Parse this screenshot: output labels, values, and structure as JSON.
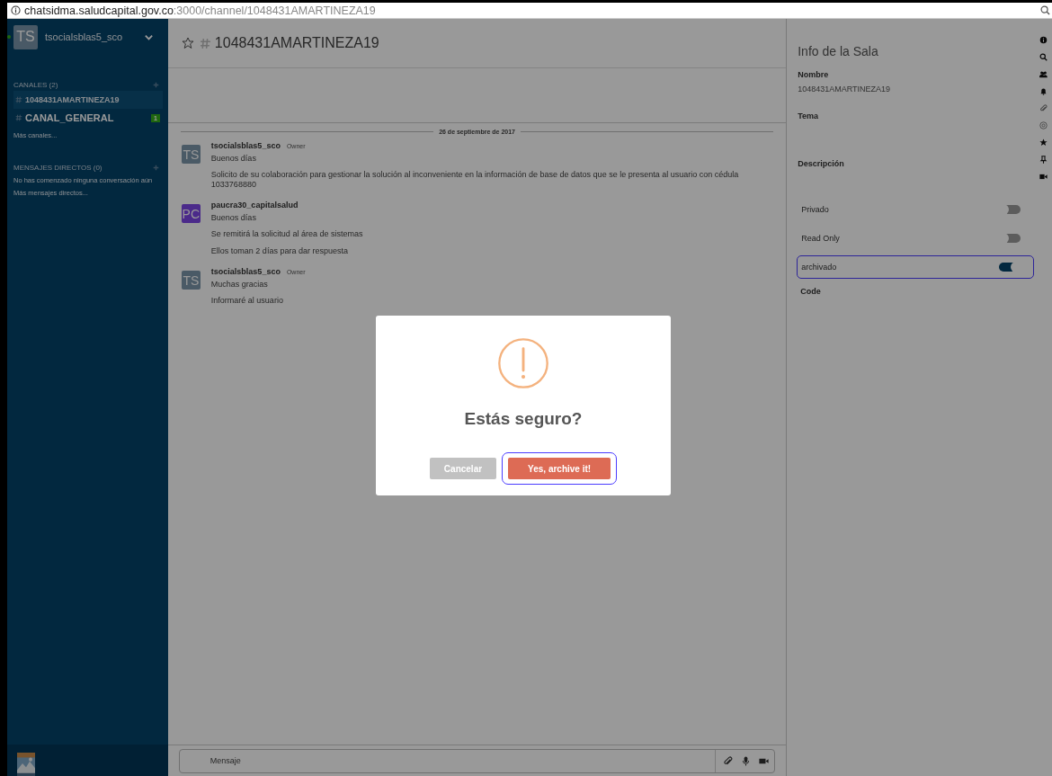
{
  "address_bar": {
    "host": "chatsidma.saludcapital.gov.co",
    "rest": ":3000/channel/1048431AMARTINEZA19"
  },
  "sidebar": {
    "user": {
      "initials": "TS",
      "name": "tsocialsblas5_sco",
      "online": true
    },
    "sections": [
      {
        "title": "CANALES (2)",
        "items": [
          {
            "name": "1048431AMARTINEZA19",
            "selected": true
          },
          {
            "name": "CANAL_GENERAL",
            "selected": false,
            "unread": "1"
          }
        ],
        "more": "Más canales..."
      },
      {
        "title": "MENSAJES DIRECTOS (0)",
        "note": "No has comenzado ninguna conversación aún",
        "more": "Más mensajes directos..."
      }
    ]
  },
  "room_header": {
    "title": "1048431AMARTINEZA19",
    "favorite": false
  },
  "date_divider": "26 de septiembre de 2017",
  "messages": [
    {
      "initials": "TS",
      "color": "#4a5a66",
      "user": "tsocialsblas5_sco",
      "role": "Owner",
      "lines": [
        "Buenos días",
        "Solicito de su colaboración para gestionar la solución al inconveniente en la información de base de datos que se le presenta al usuario con cédula 1033768880"
      ]
    },
    {
      "initials": "PC",
      "color": "#4b2a8a",
      "user": "paucra30_capitalsalud",
      "lines": [
        "Buenos días",
        "Se remitirá la solicitud al área de sistemas",
        "Ellos toman 2 días para dar respuesta"
      ]
    },
    {
      "initials": "TS",
      "color": "#4a5a66",
      "user": "tsocialsblas5_sco",
      "role": "Owner",
      "lines": [
        "Muchas gracias",
        "Informaré al usuario"
      ]
    }
  ],
  "composer": {
    "placeholder": "Mensaje"
  },
  "room_info": {
    "title": "Info de la Sala",
    "fields": [
      {
        "label": "Nombre",
        "value": "1048431AMARTINEZA19"
      },
      {
        "label": "Tema"
      },
      {
        "label": "Descripción"
      }
    ],
    "toggles": [
      {
        "label": "Privado",
        "on": false,
        "highlighted": false
      },
      {
        "label": "Read Only",
        "on": false,
        "highlighted": false
      },
      {
        "label": "archivado",
        "on": true,
        "highlighted": true
      }
    ],
    "extra_label": "Code"
  },
  "dialog": {
    "title": "Estás seguro?",
    "buttons": [
      {
        "label": "Cancelar",
        "kind": "cancel",
        "highlighted": false
      },
      {
        "label": "Yes, archive it!",
        "kind": "confirm",
        "highlighted": true
      }
    ]
  }
}
